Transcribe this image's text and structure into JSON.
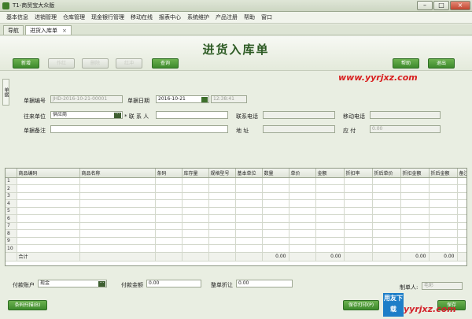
{
  "window": {
    "title": "T1-商贸宝大众版",
    "minimize": "–",
    "maximize": "□",
    "close": "×"
  },
  "menu": [
    "基本信息",
    "进销管理",
    "仓库管理",
    "现金银行管理",
    "移动在线",
    "报表中心",
    "系统维护",
    "产品注册",
    "帮助",
    "窗口"
  ],
  "tabs": [
    {
      "label": "导航"
    },
    {
      "label": "进货入库单",
      "close": "×"
    }
  ],
  "header": {
    "title": "进货入库单",
    "buttons": {
      "new": "新增",
      "copy": "作红",
      "delete": "删除",
      "print_red": "红冲",
      "query": "查询",
      "help": "帮助",
      "exit": "退出"
    }
  },
  "watermark": "www.yyrjxz.com",
  "sidetab": "单据",
  "form": {
    "doc_no_label": "单据编号",
    "doc_no": "JHD-2016-10-21-00001",
    "doc_date_label": "单据日期",
    "doc_date": "2016-10-21",
    "doc_time": "12:38:41",
    "partner_label": "往来单位",
    "partner": "供应商",
    "contact_label": "* 联 系 人",
    "contact": "",
    "phone_label": "联系电话",
    "phone": "",
    "mobile_label": "移动电话",
    "mobile": "",
    "remark_label": "单据备注",
    "remark": "",
    "address_label": "地    址",
    "address": "",
    "payable_label": "应    付",
    "payable": "0.00"
  },
  "grid": {
    "columns": [
      "商品编码",
      "商品名称",
      "条码",
      "库存量",
      "规格型号",
      "基本单位",
      "数量",
      "单价",
      "金额",
      "折扣率",
      "折后单价",
      "折扣金额",
      "折后金额",
      "备注"
    ],
    "rows": [
      "1",
      "2",
      "3",
      "4",
      "5",
      "6",
      "7",
      "8",
      "9",
      "10"
    ],
    "total_label": "合计",
    "totals": {
      "qty": "0.00",
      "amount": "0.00",
      "discount_amount": "0.00",
      "net_amount": "0.00"
    }
  },
  "footer": {
    "pay_account_label": "付款账户",
    "pay_account": "现金",
    "pay_amount_label": "付款金额",
    "pay_amount": "0.00",
    "discount_label": "整单折让",
    "discount": "0.00",
    "maker_label": "制单人:",
    "maker": "毛彩",
    "scan_button": "条码扫描(B)",
    "save_print_button": "保存打印(P)",
    "save_button": "保存",
    "logo_text": "用友下载",
    "logo_site": "yyrjxz.com"
  }
}
